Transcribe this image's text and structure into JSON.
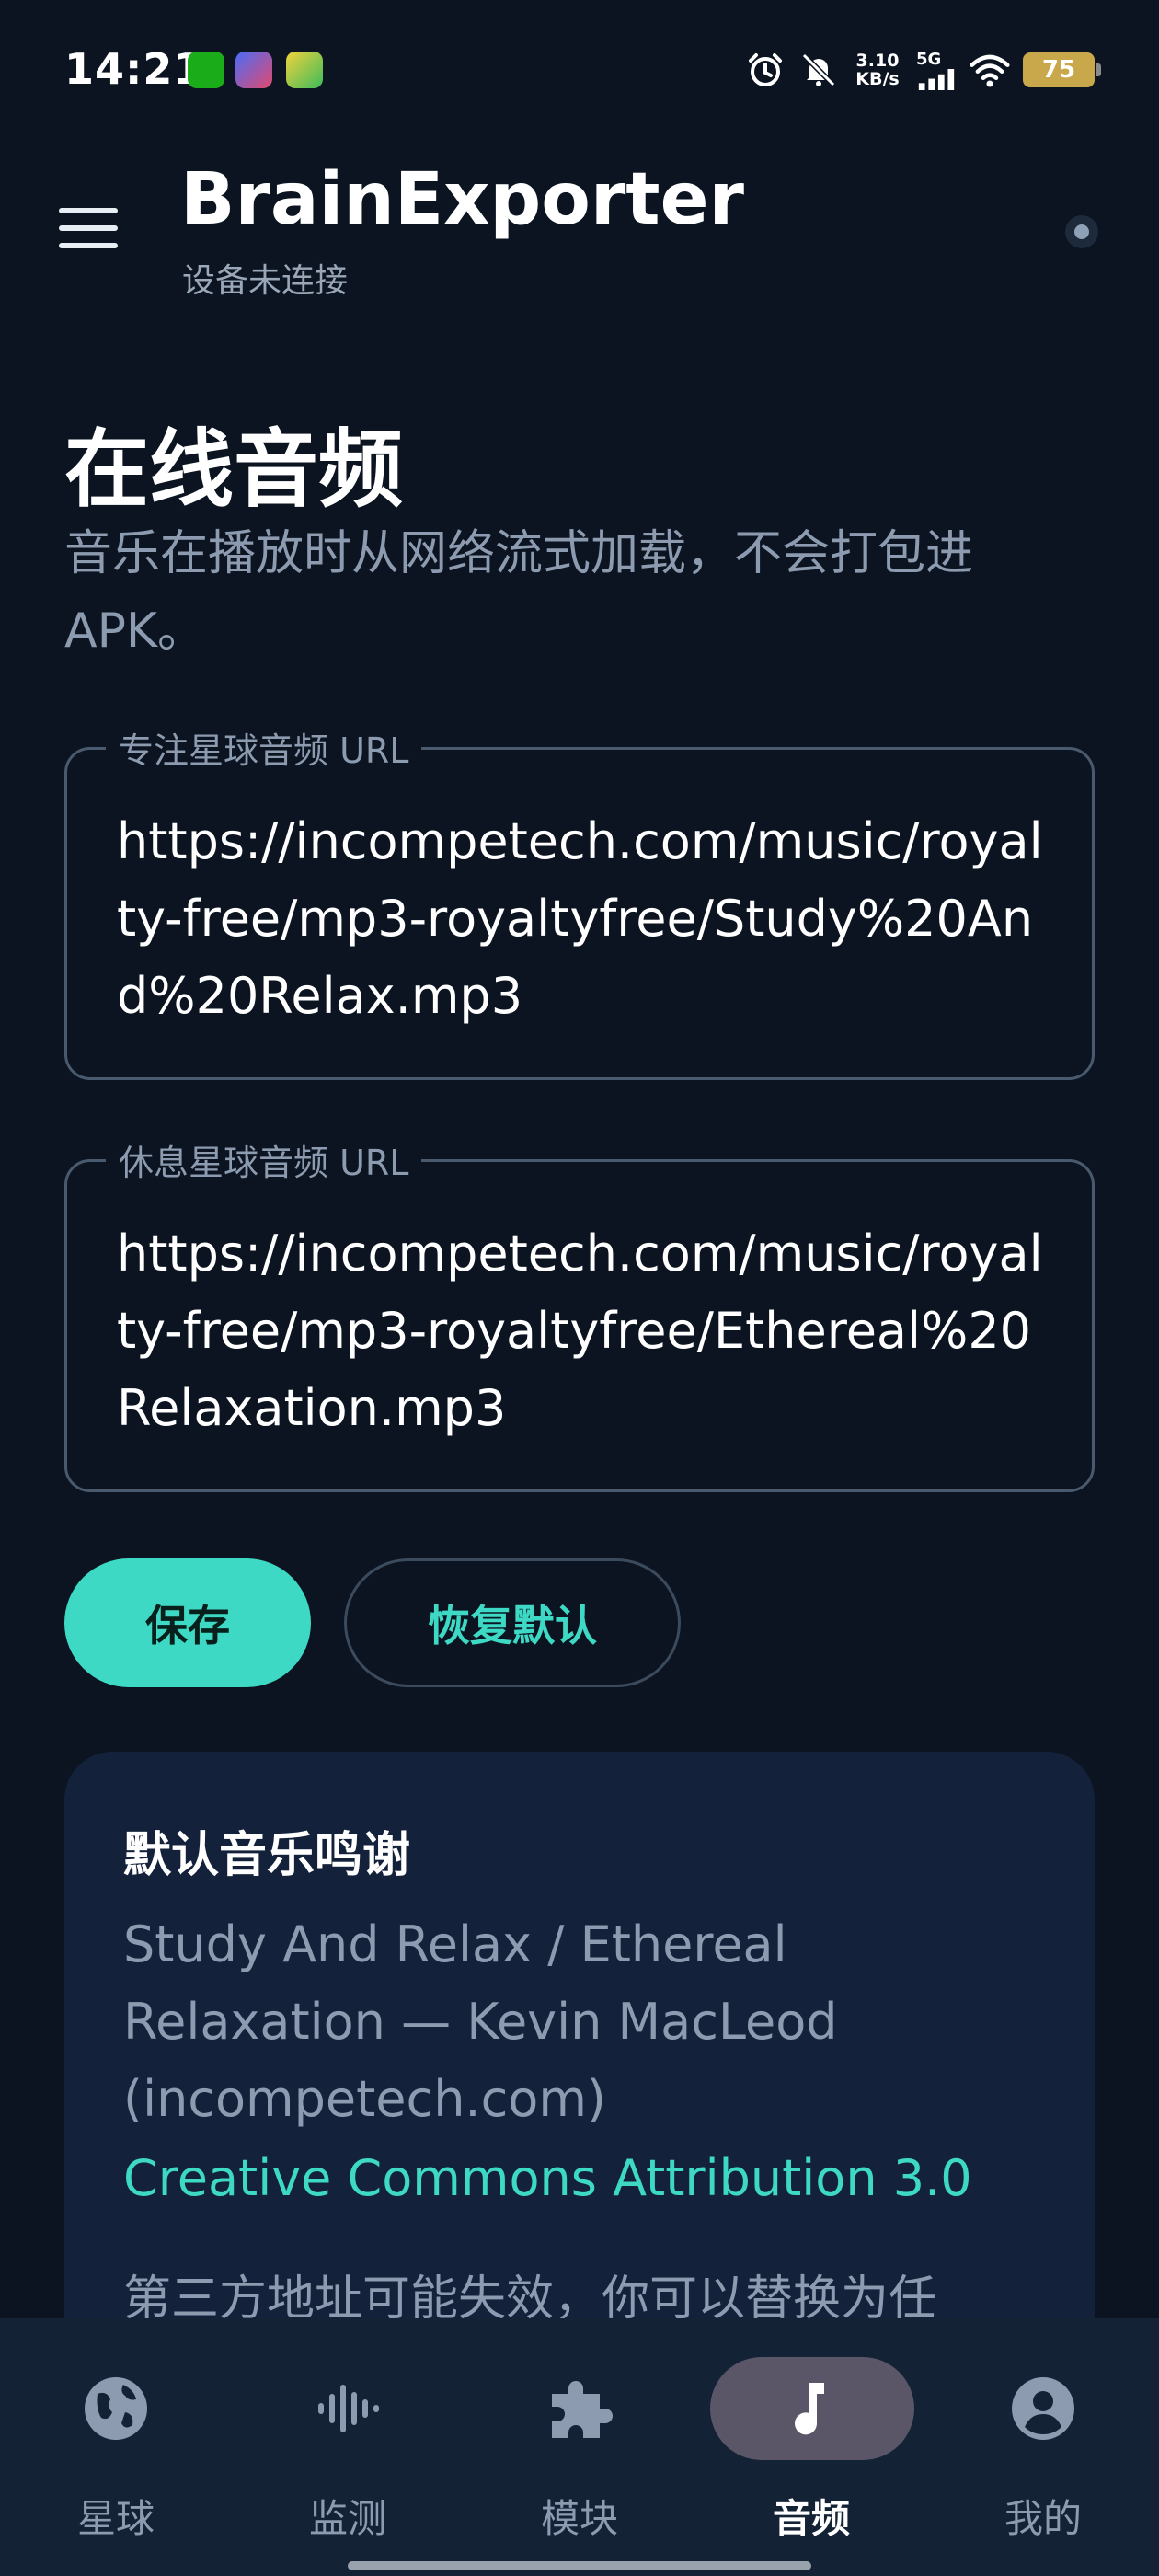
{
  "status_bar": {
    "time": "14:21",
    "net_speed_value": "3.10",
    "net_speed_unit": "KB/s",
    "network_type": "5G",
    "battery": "75",
    "icons": [
      "wechat-icon",
      "game-app-icon",
      "game-app-icon-2",
      "alarm-icon",
      "mute-icon",
      "signal-icon",
      "wifi-icon",
      "battery-icon"
    ]
  },
  "app_bar": {
    "title": "BrainExporter",
    "subtitle": "设备未连接"
  },
  "page": {
    "title": "在线音频",
    "description": "音乐在播放时从网络流式加载，不会打包进 APK。"
  },
  "fields": {
    "focus_audio": {
      "label": "专注星球音频 URL",
      "value": "https://incompetech.com/music/royalty-free/mp3-royaltyfree/Study%20And%20Relax.mp3"
    },
    "rest_audio": {
      "label": "休息星球音频 URL",
      "value": "https://incompetech.com/music/royalty-free/mp3-royaltyfree/Ethereal%20Relaxation.mp3"
    }
  },
  "actions": {
    "save": "保存",
    "reset": "恢复默认"
  },
  "credits": {
    "title": "默认音乐鸣谢",
    "text": "Study And Relax / Ethereal Relaxation — Kevin MacLeod (incompetech.com)",
    "license": "Creative Commons Attribution 3.0",
    "note": "第三方地址可能失效，你可以替换为任"
  },
  "bottom_nav": {
    "items": [
      {
        "label": "星球",
        "icon": "globe-icon"
      },
      {
        "label": "监测",
        "icon": "waveform-icon"
      },
      {
        "label": "模块",
        "icon": "puzzle-icon"
      },
      {
        "label": "音频",
        "icon": "music-note-icon"
      },
      {
        "label": "我的",
        "icon": "account-icon"
      }
    ],
    "active": "音频"
  },
  "colors": {
    "background": "#0b1420",
    "accent": "#3dd9c4",
    "card": "#13213a",
    "nav_background": "#142236",
    "active_pill": "#5a5668",
    "muted_text": "#8d9bb0"
  }
}
